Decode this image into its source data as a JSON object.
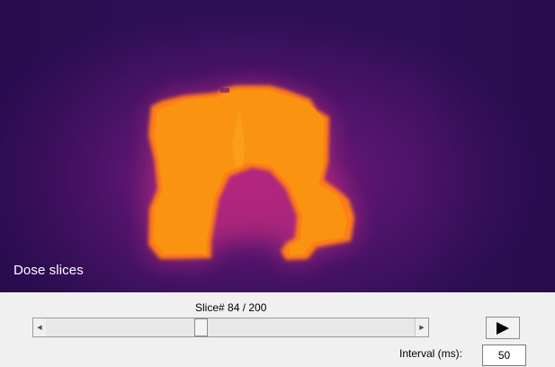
{
  "viewer": {
    "label": "Dose slices",
    "colors": {
      "background": "#34115a",
      "glow": "#c0247a",
      "dose_core": "#f8920d",
      "dose_edge": "#ff7a1a"
    }
  },
  "controls": {
    "slice_label": "Slice# 84 / 200",
    "slider": {
      "value": 84,
      "min": 1,
      "max": 200
    },
    "play_icon": "play-icon",
    "interval_label": "Interval (ms):",
    "interval_value": "50"
  }
}
